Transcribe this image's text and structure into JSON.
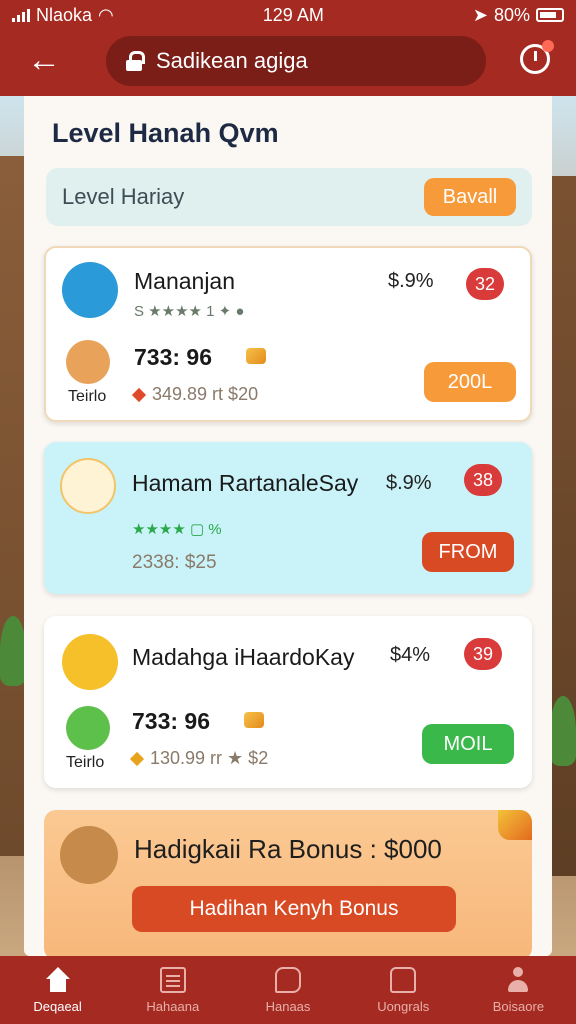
{
  "status_bar": {
    "carrier": "Nlaoka",
    "time": "129 AM",
    "battery": "80%"
  },
  "header": {
    "search_text": "Sadikean agiga"
  },
  "page": {
    "title": "Level Hanah Qvm"
  },
  "level_bar": {
    "label": "Level Hariay",
    "button": "Bavall"
  },
  "entries": [
    {
      "name": "Mananjan",
      "percent": "$.9%",
      "rank": "32",
      "rating_text": "S ★★★★ 1 ✦ ●",
      "small_label": "Teirlo",
      "value": "733: 96",
      "sub_value": "349.89 rt $20",
      "button": "200L",
      "button_color": "#f79a3a"
    },
    {
      "name": "Hamam RartanaleSay",
      "percent": "$.9%",
      "rank": "38",
      "rating_text": "★★★★ ▢ %",
      "small_label": "",
      "value": "",
      "sub_value": "2338: $25",
      "button": "FROM",
      "button_color": "#d84a24"
    },
    {
      "name": "Madahga iHaardoKay",
      "percent": "$4%",
      "rank": "39",
      "rating_text": "",
      "small_label": "Teirlo",
      "value": "733: 96",
      "sub_value": "130.99 rr ★ $2",
      "button": "MOIL",
      "button_color": "#3bb84a"
    }
  ],
  "bonus": {
    "title": "Hadigkaii Ra Bonus : $000",
    "button": "Hadihan Kenyh Bonus"
  },
  "tabs": [
    {
      "label": "Deqaeal",
      "icon": "home-icon"
    },
    {
      "label": "Hahaana",
      "icon": "list-icon"
    },
    {
      "label": "Hanaas",
      "icon": "chat-icon"
    },
    {
      "label": "Uongrals",
      "icon": "gift-icon"
    },
    {
      "label": "Boisaore",
      "icon": "user-icon"
    }
  ],
  "colors": {
    "brand": "#a52a22",
    "accent_orange": "#f79a3a",
    "rank_red": "#d93a3a",
    "card_highlight": "#c9f3f8"
  }
}
